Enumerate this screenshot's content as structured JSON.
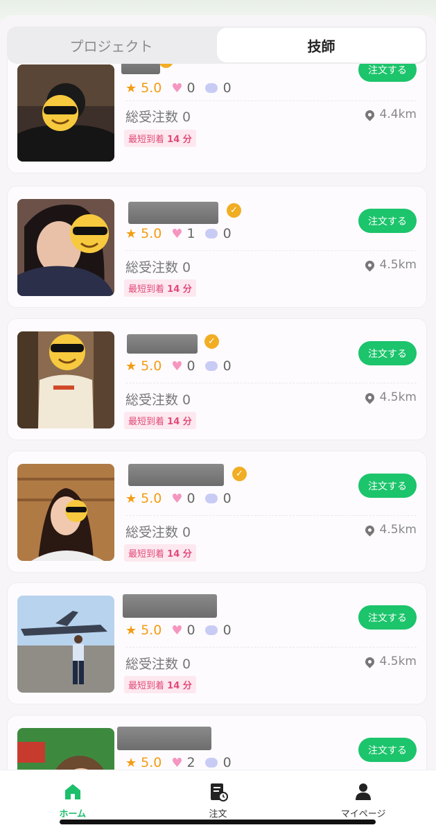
{
  "tabs": [
    {
      "label": "プロジェクト",
      "active": false
    },
    {
      "label": "技師",
      "active": true
    }
  ],
  "colors": {
    "accent": "#1cc46b",
    "star": "#f39c12",
    "heart": "#f596c0",
    "arrival_text": "#e04b7b"
  },
  "cards": [
    {
      "rating": "5.0",
      "likes": "0",
      "comments": "0",
      "orders": "総受注数 0",
      "distance": "4.4km",
      "arrival_prefix": "最短到着",
      "arrival_value": "14 分",
      "button": "注文する"
    },
    {
      "rating": "5.0",
      "likes": "1",
      "comments": "0",
      "orders": "総受注数 0",
      "distance": "4.5km",
      "arrival_prefix": "最短到着",
      "arrival_value": "14 分",
      "button": "注文する"
    },
    {
      "rating": "5.0",
      "likes": "0",
      "comments": "0",
      "orders": "総受注数 0",
      "distance": "4.5km",
      "arrival_prefix": "最短到着",
      "arrival_value": "14 分",
      "button": "注文する"
    },
    {
      "rating": "5.0",
      "likes": "0",
      "comments": "0",
      "orders": "総受注数 0",
      "distance": "4.5km",
      "arrival_prefix": "最短到着",
      "arrival_value": "14 分",
      "button": "注文する"
    },
    {
      "rating": "5.0",
      "likes": "0",
      "comments": "0",
      "orders": "総受注数 0",
      "distance": "4.5km",
      "arrival_prefix": "最短到着",
      "arrival_value": "14 分",
      "button": "注文する"
    },
    {
      "rating": "5.0",
      "likes": "2",
      "comments": "0",
      "button": "注文する"
    }
  ],
  "icons": {
    "rating": "star-icon",
    "likes": "heart-icon",
    "comments": "comment-icon",
    "distance": "location-pin-icon",
    "verified": "verified-badge-icon"
  },
  "bottom_nav": [
    {
      "label": "ホーム",
      "icon": "home-icon",
      "active": true
    },
    {
      "label": "注文",
      "icon": "order-icon",
      "active": false
    },
    {
      "label": "マイページ",
      "icon": "user-icon",
      "active": false
    }
  ]
}
